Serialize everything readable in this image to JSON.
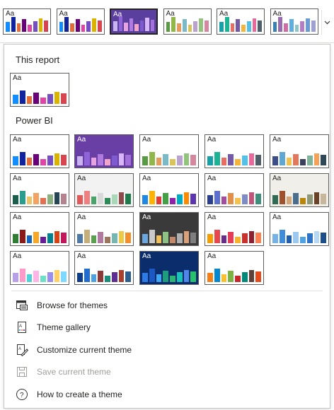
{
  "aa_text": "Aa",
  "strip": {
    "themes": [
      {
        "bg": "#ffffff",
        "text": "#252423",
        "bars": [
          "#118DFF",
          "#12239E",
          "#E66C37",
          "#6B007B",
          "#E044A7",
          "#744EC2",
          "#D9B300",
          "#D64550"
        ],
        "selected": false
      },
      {
        "bg": "#ffffff",
        "text": "#252423",
        "bars": [
          "#118DFF",
          "#12239E",
          "#E66C37",
          "#6B007B",
          "#E044A7",
          "#744EC2",
          "#D9B300",
          "#D64550"
        ],
        "selected": false
      },
      {
        "bg": "#5B3F9E",
        "text": "#ffffff",
        "bars": [
          "#C9B3F0",
          "#8E64D8",
          "#E7A3E0",
          "#B07BE0",
          "#F0A6CA",
          "#7F5BD0",
          "#D7B7F7",
          "#A371D9"
        ],
        "selected": true
      },
      {
        "bg": "#ffffff",
        "text": "#252423",
        "bars": [
          "#599B43",
          "#91B74A",
          "#E59B5D",
          "#7BB9C6",
          "#D8C45B",
          "#BAA2CF",
          "#93C47D",
          "#D6869E"
        ],
        "selected": false
      },
      {
        "bg": "#ffffff",
        "text": "#252423",
        "bars": [
          "#16A0A8",
          "#1AB394",
          "#E86D63",
          "#7459A6",
          "#F3B53B",
          "#54C0E6",
          "#E66A9C",
          "#4E5E6B"
        ],
        "selected": false
      },
      {
        "bg": "#ffffff",
        "text": "#252423",
        "bars": [
          "#3C7FB5",
          "#9A6BB0",
          "#D16BA5",
          "#5BB0E0",
          "#8CC6C4",
          "#B37FC2",
          "#6B9BD1",
          "#A0A0D0"
        ],
        "selected": false
      }
    ],
    "scroll_icon": "chevron-down-icon"
  },
  "panel": {
    "this_report_heading": "This report",
    "power_bi_heading": "Power BI",
    "this_report_theme": {
      "bg": "#ffffff",
      "text": "#252423",
      "bars": [
        "#118DFF",
        "#12239E",
        "#E66C37",
        "#6B007B",
        "#E044A7",
        "#744EC2",
        "#D9B300",
        "#D64550"
      ]
    },
    "themes": [
      {
        "bg": "#ffffff",
        "text": "#252423",
        "bars": [
          "#118DFF",
          "#12239E",
          "#E66C37",
          "#6B007B",
          "#E044A7",
          "#744EC2",
          "#D9B300",
          "#D64550"
        ]
      },
      {
        "bg": "#6A3FA5",
        "text": "#ffffff",
        "bars": [
          "#C9B3F0",
          "#8E64D8",
          "#E7A3E0",
          "#B07BE0",
          "#F0A6CA",
          "#7F5BD0",
          "#D7B7F7",
          "#A371D9"
        ]
      },
      {
        "bg": "#ffffff",
        "text": "#252423",
        "bars": [
          "#599B43",
          "#91B74A",
          "#E59B5D",
          "#7BB9C6",
          "#D8C45B",
          "#BAA2CF",
          "#93C47D",
          "#D6869E"
        ]
      },
      {
        "bg": "#ffffff",
        "text": "#252423",
        "bars": [
          "#16A0A8",
          "#1AB394",
          "#E86D63",
          "#7459A6",
          "#F3B53B",
          "#54C0E6",
          "#E66A9C",
          "#4E5E6B"
        ]
      },
      {
        "bg": "#ffffff",
        "text": "#252423",
        "bars": [
          "#3C4D8A",
          "#5FA8D3",
          "#F2C14E",
          "#E07A5F",
          "#3D405B",
          "#81B29A",
          "#F4A259",
          "#2F4858"
        ]
      },
      {
        "bg": "#ffffff",
        "text": "#252423",
        "bars": [
          "#1B5E4C",
          "#2A9D8F",
          "#E9C46A",
          "#F4A261",
          "#E76F51",
          "#8AB17D",
          "#264653",
          "#B5838D"
        ]
      },
      {
        "bg": "#f2f2f2",
        "text": "#252423",
        "bars": [
          "#E05A5A",
          "#F08080",
          "#4AA36B",
          "#D9D9D9",
          "#2E8B57",
          "#A9D8B8",
          "#8C4A4A",
          "#1F7A4C"
        ]
      },
      {
        "bg": "#ffffff",
        "text": "#252423",
        "bars": [
          "#1E88E5",
          "#FFB300",
          "#E53935",
          "#43A047",
          "#8E24AA",
          "#00ACC1",
          "#FB8C00",
          "#5E35B1"
        ]
      },
      {
        "bg": "#ffffff",
        "text": "#252423",
        "bars": [
          "#2A3F8F",
          "#5A6FD0",
          "#A44D9E",
          "#E0904A",
          "#F2C14E",
          "#7D8CC4",
          "#C0567C",
          "#3E8E7E"
        ]
      },
      {
        "bg": "#f0efe9",
        "text": "#252423",
        "bars": [
          "#2F6B54",
          "#A0522D",
          "#D2A679",
          "#4B6E8C",
          "#B8860B",
          "#8F9779",
          "#6B4226",
          "#C9B79C"
        ]
      },
      {
        "bg": "#ffffff",
        "text": "#252423",
        "bars": [
          "#2E7D32",
          "#8B1A1A",
          "#1565C0",
          "#F9A825",
          "#6A1B9A",
          "#00838F",
          "#D84315",
          "#C2185B"
        ]
      },
      {
        "bg": "#ffffff",
        "text": "#252423",
        "bars": [
          "#4E79A7",
          "#C6AE7A",
          "#59A14F",
          "#B07AA1",
          "#9C755F",
          "#76B7B2",
          "#EDC948",
          "#F28E2B"
        ]
      },
      {
        "bg": "#3a3a3a",
        "text": "#ffffff",
        "bars": [
          "#6AA7E0",
          "#C9C9C9",
          "#F0C05A",
          "#8CC084",
          "#C28A6B",
          "#B0B0B0",
          "#D9A07A",
          "#7F7F7F"
        ]
      },
      {
        "bg": "#ffffff",
        "text": "#252423",
        "bars": [
          "#F59C00",
          "#E8484D",
          "#6B2D8C",
          "#E23E57",
          "#F7B32B",
          "#C7322E",
          "#8E1F2F",
          "#FF7F50"
        ]
      },
      {
        "bg": "#ffffff",
        "text": "#252423",
        "bars": [
          "#74B3E8",
          "#3C8DDC",
          "#1F5FAD",
          "#9BC9F0",
          "#4FA3E3",
          "#2E73C6",
          "#B7D8F5",
          "#1C4E8C"
        ]
      },
      {
        "bg": "#ffffff",
        "text": "#252423",
        "bars": [
          "#B7A0E8",
          "#FF9BC8",
          "#4ED1D9",
          "#FFB3E6",
          "#6BE0C8",
          "#9A8FF0",
          "#FFD166",
          "#7FD8FF"
        ]
      },
      {
        "bg": "#ffffff",
        "text": "#252423",
        "bars": [
          "#0F3D8C",
          "#1F6DD1",
          "#4EA2E0",
          "#8C3B3B",
          "#1A8C7A",
          "#5E2D91",
          "#A8402C",
          "#2C5F8F"
        ]
      },
      {
        "bg": "#0b2d6b",
        "text": "#ffffff",
        "bars": [
          "#2E7BE8",
          "#1C58C4",
          "#3FA7F2",
          "#1E9E7A",
          "#2BB673",
          "#19C2B7",
          "#4F86E8",
          "#27C36B"
        ]
      },
      {
        "bg": "#ffffff",
        "text": "#252423",
        "bars": [
          "#F57F17",
          "#0288D1",
          "#FBC02D",
          "#7CB342",
          "#C62828",
          "#00897B",
          "#5D4037",
          "#E64A19"
        ]
      }
    ]
  },
  "menu": [
    {
      "label": "Browse for themes",
      "icon": "browse-folder-icon",
      "enabled": true
    },
    {
      "label": "Theme gallery",
      "icon": "theme-gallery-icon",
      "enabled": true
    },
    {
      "label": "Customize current theme",
      "icon": "customize-pen-icon",
      "enabled": true
    },
    {
      "label": "Save current theme",
      "icon": "save-disk-icon",
      "enabled": false
    },
    {
      "label": "How to create a theme",
      "icon": "help-question-icon",
      "enabled": true
    }
  ]
}
